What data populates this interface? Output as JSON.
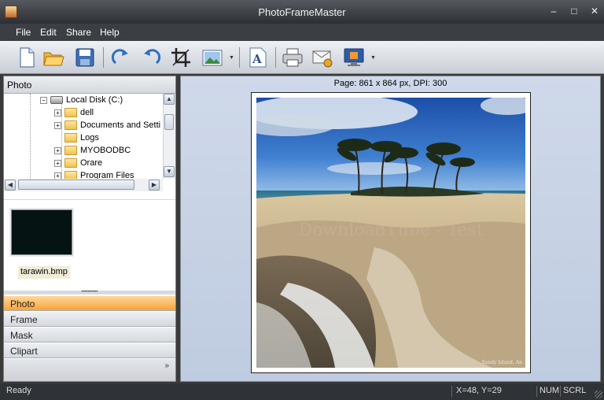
{
  "window": {
    "title": "PhotoFrameMaster",
    "minimize": "–",
    "maximize": "□",
    "close": "✕"
  },
  "menu": [
    "File",
    "Edit",
    "Share",
    "Help"
  ],
  "toolbar": {
    "icons": [
      "new-file-icon",
      "open-folder-icon",
      "save-icon",
      "redo-icon",
      "undo-icon",
      "crop-icon",
      "insert-image-icon",
      "text-icon",
      "print-icon",
      "email-icon",
      "wallpaper-icon"
    ]
  },
  "left_panel": {
    "header": "Photo",
    "tree": {
      "root": "Local Disk (C:)",
      "items": [
        "dell",
        "Documents and Setti",
        "Logs",
        "MYOBODBC",
        "Orare",
        "Program Files"
      ]
    },
    "thumbnail": {
      "label": "tarawin.bmp"
    },
    "nav": [
      "Photo",
      "Frame",
      "Mask",
      "Clipart"
    ],
    "nav_more": "»"
  },
  "canvas": {
    "page_info": "Page: 861 x 864 px, DPI: 300",
    "watermark": "DownloadTube - Test",
    "photo_caption": "Sandy Island, An"
  },
  "status": {
    "text": "Ready",
    "coords": "X=48, Y=29",
    "num": "NUM",
    "scrl": "SCRL"
  }
}
